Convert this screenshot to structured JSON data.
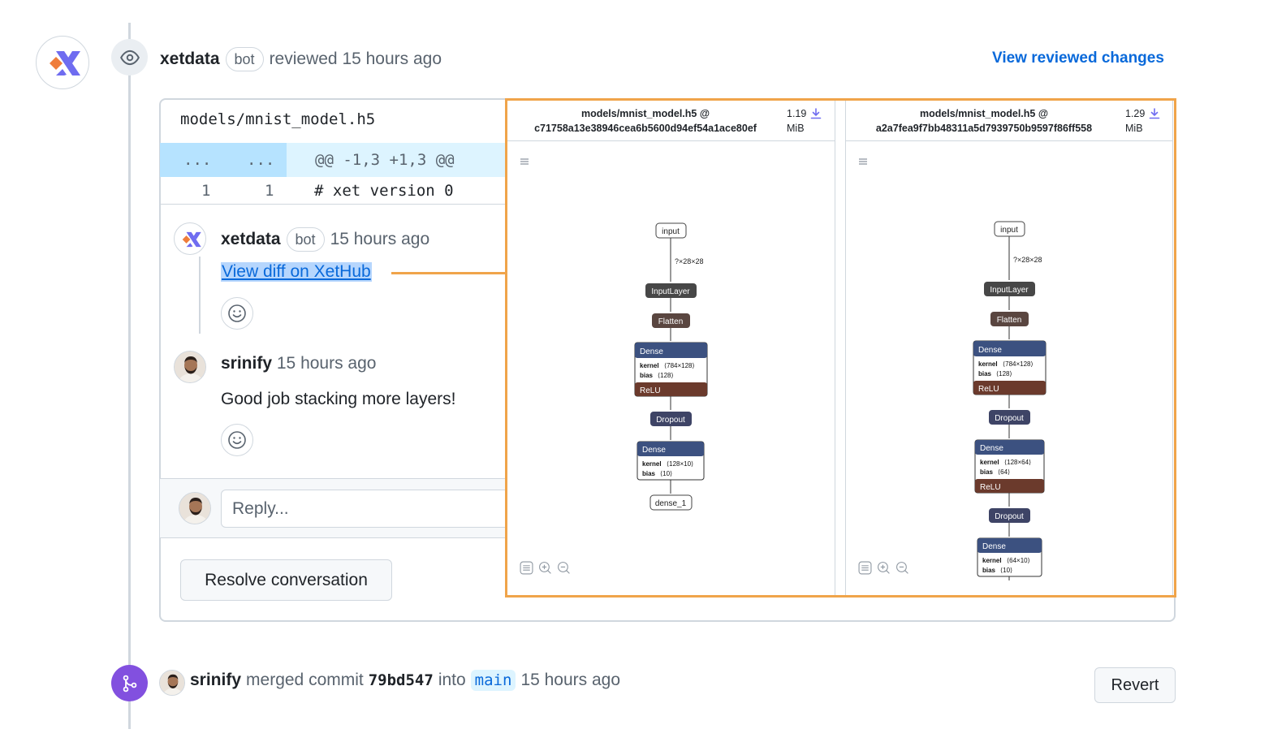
{
  "review": {
    "author": "xetdata",
    "bot_badge": "bot",
    "action": "reviewed 15 hours ago",
    "view_changes_link": "View reviewed changes"
  },
  "diff": {
    "file_name": "models/mnist_model.h5",
    "hunk": {
      "left": "...",
      "right": "...",
      "header": "@@ -1,3 +1,3 @@"
    },
    "lines": [
      {
        "old": "1",
        "new": "1",
        "code": "# xet version 0"
      }
    ]
  },
  "thread": {
    "comment1": {
      "author": "xetdata",
      "badge": "bot",
      "time": "15 hours ago",
      "link": "View diff on XetHub"
    },
    "comment2": {
      "author": "srinify",
      "time": "15 hours ago",
      "body": "Good job stacking more layers!"
    },
    "reply_placeholder": "Reply...",
    "resolve_label": "Resolve conversation"
  },
  "model_panels": {
    "left": {
      "title_line1": "models/mnist_model.h5 @",
      "title_line2": "c71758a13e38946cea6b5600d94ef54a1ace80ef",
      "size_value": "1.19",
      "size_unit": "MiB",
      "nodes": {
        "input": "input",
        "shape": "?×28×28",
        "input_layer": "InputLayer",
        "flatten": "Flatten",
        "dense1": {
          "title": "Dense",
          "kernel_label": "kernel",
          "kernel_value": "⟨784×128⟩",
          "bias_label": "bias",
          "bias_value": "⟨128⟩",
          "activation": "ReLU"
        },
        "dropout": "Dropout",
        "dense2": {
          "title": "Dense",
          "kernel_label": "kernel",
          "kernel_value": "⟨128×10⟩",
          "bias_label": "bias",
          "bias_value": "⟨10⟩"
        },
        "output": "dense_1"
      }
    },
    "right": {
      "title_line1": "models/mnist_model.h5 @",
      "title_line2": "a2a7fea9f7bb48311a5d7939750b9597f86ff558",
      "size_value": "1.29",
      "size_unit": "MiB",
      "nodes": {
        "input": "input",
        "shape": "?×28×28",
        "input_layer": "InputLayer",
        "flatten": "Flatten",
        "dense1": {
          "title": "Dense",
          "kernel_label": "kernel",
          "kernel_value": "⟨784×128⟩",
          "bias_label": "bias",
          "bias_value": "⟨128⟩",
          "activation": "ReLU"
        },
        "dropout1": "Dropout",
        "dense2": {
          "title": "Dense",
          "kernel_label": "kernel",
          "kernel_value": "⟨128×64⟩",
          "bias_label": "bias",
          "bias_value": "⟨64⟩",
          "activation": "ReLU"
        },
        "dropout2": "Dropout",
        "dense3": {
          "title": "Dense",
          "kernel_label": "kernel",
          "kernel_value": "⟨64×10⟩",
          "bias_label": "bias",
          "bias_value": "⟨10⟩"
        }
      }
    }
  },
  "merge": {
    "author": "srinify",
    "action": "merged commit",
    "commit": "79bd547",
    "into": "into",
    "branch": "main",
    "time": "15 hours ago",
    "revert_label": "Revert"
  },
  "colors": {
    "link": "#0969da",
    "highlight": "#f0a44a",
    "hunk_bg": "#ddf4ff",
    "merge_badge": "#8250df",
    "dense_node": "#3c5180",
    "relu_node": "#6b3a2c",
    "dark_node": "#474747",
    "flatten_node": "#5a4640"
  },
  "icons": [
    "eye-icon",
    "xethub-logo-icon",
    "smiley-icon",
    "merge-icon",
    "download-icon",
    "menu-icon",
    "list-icon",
    "zoom-in-icon",
    "zoom-out-icon"
  ]
}
